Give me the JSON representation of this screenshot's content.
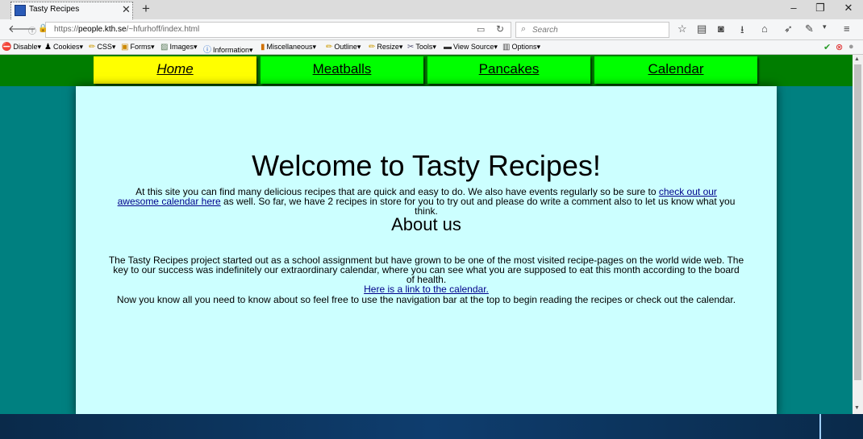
{
  "browser": {
    "tab_title": "Tasty Recipes",
    "url_domain": "people.kth.se",
    "url_prefix": "https://",
    "url_path": "/~hfurhoff/index.html",
    "search_placeholder": "Search"
  },
  "bookmarks": [
    {
      "label": "Disable",
      "icon": "no-entry-icon"
    },
    {
      "label": "Cookies",
      "icon": "person-icon"
    },
    {
      "label": "CSS",
      "icon": "pencil-icon"
    },
    {
      "label": "Forms",
      "icon": "form-icon"
    },
    {
      "label": "Images",
      "icon": "image-icon"
    },
    {
      "label": "Information",
      "icon": "info-icon"
    },
    {
      "label": "Miscellaneous",
      "icon": "misc-icon"
    },
    {
      "label": "Outline",
      "icon": "pencil-icon"
    },
    {
      "label": "Resize",
      "icon": "pencil-icon"
    },
    {
      "label": "Tools",
      "icon": "tools-icon"
    },
    {
      "label": "View Source",
      "icon": "monitor-icon"
    },
    {
      "label": "Options",
      "icon": "options-icon"
    }
  ],
  "site_nav": {
    "home": "Home",
    "meatballs": "Meatballs",
    "pancakes": "Pancakes",
    "calendar": "Calendar"
  },
  "content": {
    "title": "Welcome to Tasty Recipes!",
    "intro_before": "At this site you can find many delicious recipes that are quick and easy to do. We also have events regularly so be sure to ",
    "intro_link": "check out our awesome calendar here",
    "intro_after": " as well. So far, we have 2 recipes in store for you to try out and please do write a comment also to let us know what you think.",
    "about_heading": "About us",
    "about_text": "The Tasty Recipes project started out as a school assignment but have grown to be one of the most visited recipe-pages on the world wide web. The key to our success was indefinitely our extraordinary calendar, where you can see what you are supposed to eat this month according to the board of health.",
    "about_link": "Here is a link to the calendar.",
    "outro": "Now you know all you need to know about so feel free to use the navigation bar at the top to begin reading the recipes or check out the calendar."
  },
  "colors": {
    "page_background": "#008080",
    "nav_bar": "#007d00",
    "nav_button": "#00ff00",
    "nav_button_active": "#ffff00",
    "content_background": "#ccffff"
  }
}
